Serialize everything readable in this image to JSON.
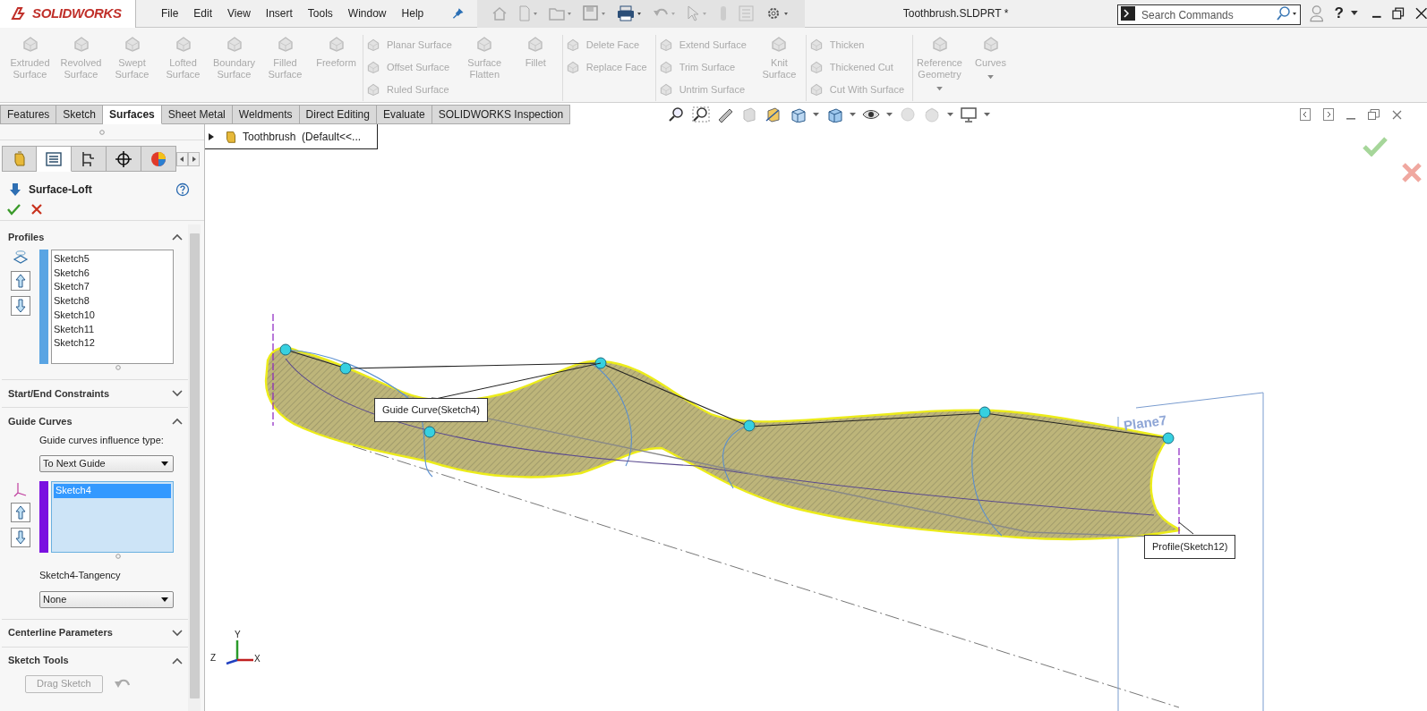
{
  "app": {
    "logo": "SOLIDWORKS",
    "menu": [
      "File",
      "Edit",
      "View",
      "Insert",
      "Tools",
      "Window",
      "Help"
    ],
    "title": "Toothbrush.SLDPRT *",
    "search": {
      "placeholder": "Search Commands"
    },
    "help": "?"
  },
  "ribbon": [
    {
      "items": [
        {
          "kind": "large",
          "label": "Extruded Surface",
          "disabled": true
        },
        {
          "kind": "large",
          "label": "Revolved Surface",
          "disabled": true
        },
        {
          "kind": "large",
          "label": "Swept Surface",
          "disabled": true
        },
        {
          "kind": "large",
          "label": "Lofted Surface",
          "disabled": true
        },
        {
          "kind": "large",
          "label": "Boundary Surface",
          "disabled": true
        },
        {
          "kind": "large",
          "label": "Filled Surface",
          "disabled": true
        },
        {
          "kind": "large",
          "label": "Freeform",
          "disabled": true
        }
      ]
    },
    {
      "items": [
        {
          "kind": "small",
          "label": "Planar Surface",
          "disabled": true
        },
        {
          "kind": "small",
          "label": "Offset Surface",
          "disabled": true
        },
        {
          "kind": "small",
          "label": "Ruled Surface",
          "disabled": true
        },
        {
          "kind": "large",
          "label": "Surface Flatten",
          "disabled": true
        },
        {
          "kind": "large",
          "label": "Fillet",
          "disabled": true
        }
      ]
    },
    {
      "items": [
        {
          "kind": "small",
          "label": "Delete Face",
          "disabled": true
        },
        {
          "kind": "small",
          "label": "Replace Face",
          "disabled": true
        }
      ]
    },
    {
      "items": [
        {
          "kind": "small",
          "label": "Extend Surface",
          "disabled": true
        },
        {
          "kind": "small",
          "label": "Trim Surface",
          "disabled": true
        },
        {
          "kind": "small",
          "label": "Untrim Surface",
          "disabled": true
        },
        {
          "kind": "large",
          "label": "Knit Surface",
          "disabled": true
        }
      ]
    },
    {
      "items": [
        {
          "kind": "small",
          "label": "Thicken",
          "disabled": true
        },
        {
          "kind": "small",
          "label": "Thickened Cut",
          "disabled": true
        },
        {
          "kind": "small",
          "label": "Cut With Surface",
          "disabled": true
        }
      ]
    },
    {
      "items": [
        {
          "kind": "large",
          "label": "Reference Geometry",
          "disabled": true,
          "dropdown": true
        },
        {
          "kind": "large",
          "label": "Curves",
          "disabled": true,
          "dropdown": true
        }
      ]
    }
  ],
  "tabs": [
    {
      "label": "Features",
      "selected": false
    },
    {
      "label": "Sketch",
      "selected": false
    },
    {
      "label": "Surfaces",
      "selected": true
    },
    {
      "label": "Sheet Metal",
      "selected": false
    },
    {
      "label": "Weldments",
      "selected": false
    },
    {
      "label": "Direct Editing",
      "selected": false
    },
    {
      "label": "Evaluate",
      "selected": false
    },
    {
      "label": "SOLIDWORKS Inspection",
      "selected": false
    }
  ],
  "panel_tabs": [
    {
      "kind": "tree",
      "selected": false
    },
    {
      "kind": "property",
      "selected": true
    },
    {
      "kind": "config",
      "selected": false
    },
    {
      "kind": "dim",
      "selected": false
    },
    {
      "kind": "appearance",
      "selected": false
    }
  ],
  "property_manager": {
    "title": "Surface-Loft",
    "sections": [
      {
        "kind": "profiles",
        "title": "Profiles",
        "expanded": true,
        "items": [
          {
            "label": "Sketch5"
          },
          {
            "label": "Sketch6"
          },
          {
            "label": "Sketch7"
          },
          {
            "label": "Sketch8"
          },
          {
            "label": "Sketch10"
          },
          {
            "label": "Sketch11"
          },
          {
            "label": "Sketch12"
          }
        ]
      },
      {
        "kind": "plain",
        "title": "Start/End Constraints",
        "expanded": false
      },
      {
        "kind": "guides",
        "title": "Guide Curves",
        "expanded": true,
        "influence_label": "Guide curves influence type:",
        "influence_value": "To Next Guide",
        "items": [
          {
            "label": "Sketch4",
            "selected": true
          }
        ],
        "tangency_label": "Sketch4-Tangency",
        "tangency_value": "None"
      },
      {
        "kind": "plain",
        "title": "Centerline Parameters",
        "expanded": false
      },
      {
        "kind": "tools",
        "title": "Sketch Tools",
        "expanded": true,
        "button": {
          "label": "Drag Sketch",
          "disabled": true
        }
      }
    ]
  },
  "feature_tree": {
    "label": "Toothbrush  (Default<<..."
  },
  "viewport": {
    "callouts": [
      {
        "kind": "guide",
        "label": "Guide Curve(Sketch4)"
      },
      {
        "kind": "profile",
        "label": "Profile(Sketch12)"
      }
    ],
    "plane_label": "Plane7",
    "axes": [
      "X",
      "Y",
      "Z"
    ]
  }
}
